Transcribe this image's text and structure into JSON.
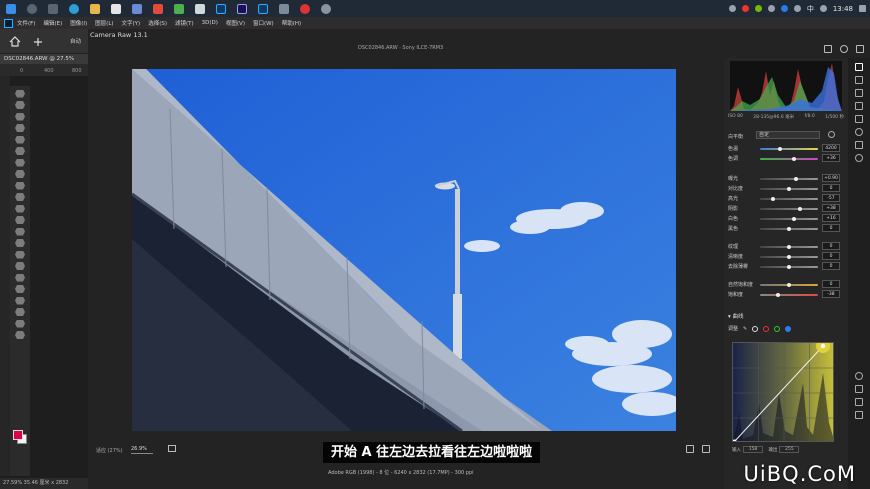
{
  "taskbar": {
    "clock": "13:48",
    "ime": "中"
  },
  "photoshop": {
    "menu": [
      "文件(F)",
      "编辑(E)",
      "图像(I)",
      "图层(L)",
      "文字(Y)",
      "选择(S)",
      "滤镜(T)",
      "3D(D)",
      "视图(V)",
      "窗口(W)",
      "帮助(H)"
    ],
    "options_auto": "自动",
    "doc_tab": "DSC02846.ARW @ 27.5%",
    "ruler_ticks": [
      "0",
      "400",
      "800"
    ],
    "status": "27.59%   35.46 厘米 x 2832"
  },
  "camera_raw": {
    "title": "Camera Raw 13.1",
    "file_info": "DSC02846.ARW  ·  Sony ILCE-7RM3",
    "zoom_label": "适应 (27%)",
    "zoom_value": "26.9%",
    "subtitle": "开始 A 往左边去拉看往左边啦啦啦",
    "exif_line": "Adobe RGB (1998) - 8 位 - 6240 x 2832 (17.7MP) - 300 ppi",
    "camera_info": [
      "ISO 80",
      "28-135@96.6 毫米",
      "f/8.0",
      "1/500 秒"
    ],
    "white_balance": {
      "label": "白平衡",
      "value": "自定"
    },
    "sliders": [
      {
        "label": "色温",
        "value": "4200",
        "pos": 0.35,
        "track": "temp"
      },
      {
        "label": "色调",
        "value": "+36",
        "pos": 0.58,
        "track": "tint"
      },
      {
        "label": "曝光",
        "value": "+0.90",
        "pos": 0.62,
        "track": "grey"
      },
      {
        "label": "对比度",
        "value": "0",
        "pos": 0.5,
        "track": "grey"
      },
      {
        "label": "高光",
        "value": "-57",
        "pos": 0.22,
        "track": "grey"
      },
      {
        "label": "阴影",
        "value": "+38",
        "pos": 0.69,
        "track": "grey"
      },
      {
        "label": "白色",
        "value": "+16",
        "pos": 0.58,
        "track": "grey"
      },
      {
        "label": "黑色",
        "value": "0",
        "pos": 0.5,
        "track": "grey"
      },
      {
        "label": "纹理",
        "value": "0",
        "pos": 0.5,
        "track": "grey"
      },
      {
        "label": "清晰度",
        "value": "0",
        "pos": 0.5,
        "track": "grey"
      },
      {
        "label": "去除薄雾",
        "value": "0",
        "pos": 0.5,
        "track": "grey"
      },
      {
        "label": "自然饱和度",
        "value": "0",
        "pos": 0.5,
        "track": "vib"
      },
      {
        "label": "饱和度",
        "value": "-38",
        "pos": 0.31,
        "track": "sat"
      }
    ],
    "curve": {
      "header": "曲线",
      "adjust_label": "调整",
      "input_label": "输入",
      "input_value": "158",
      "output_label": "输出",
      "output_value": "255"
    }
  },
  "watermark": "UiBQ.CoM"
}
